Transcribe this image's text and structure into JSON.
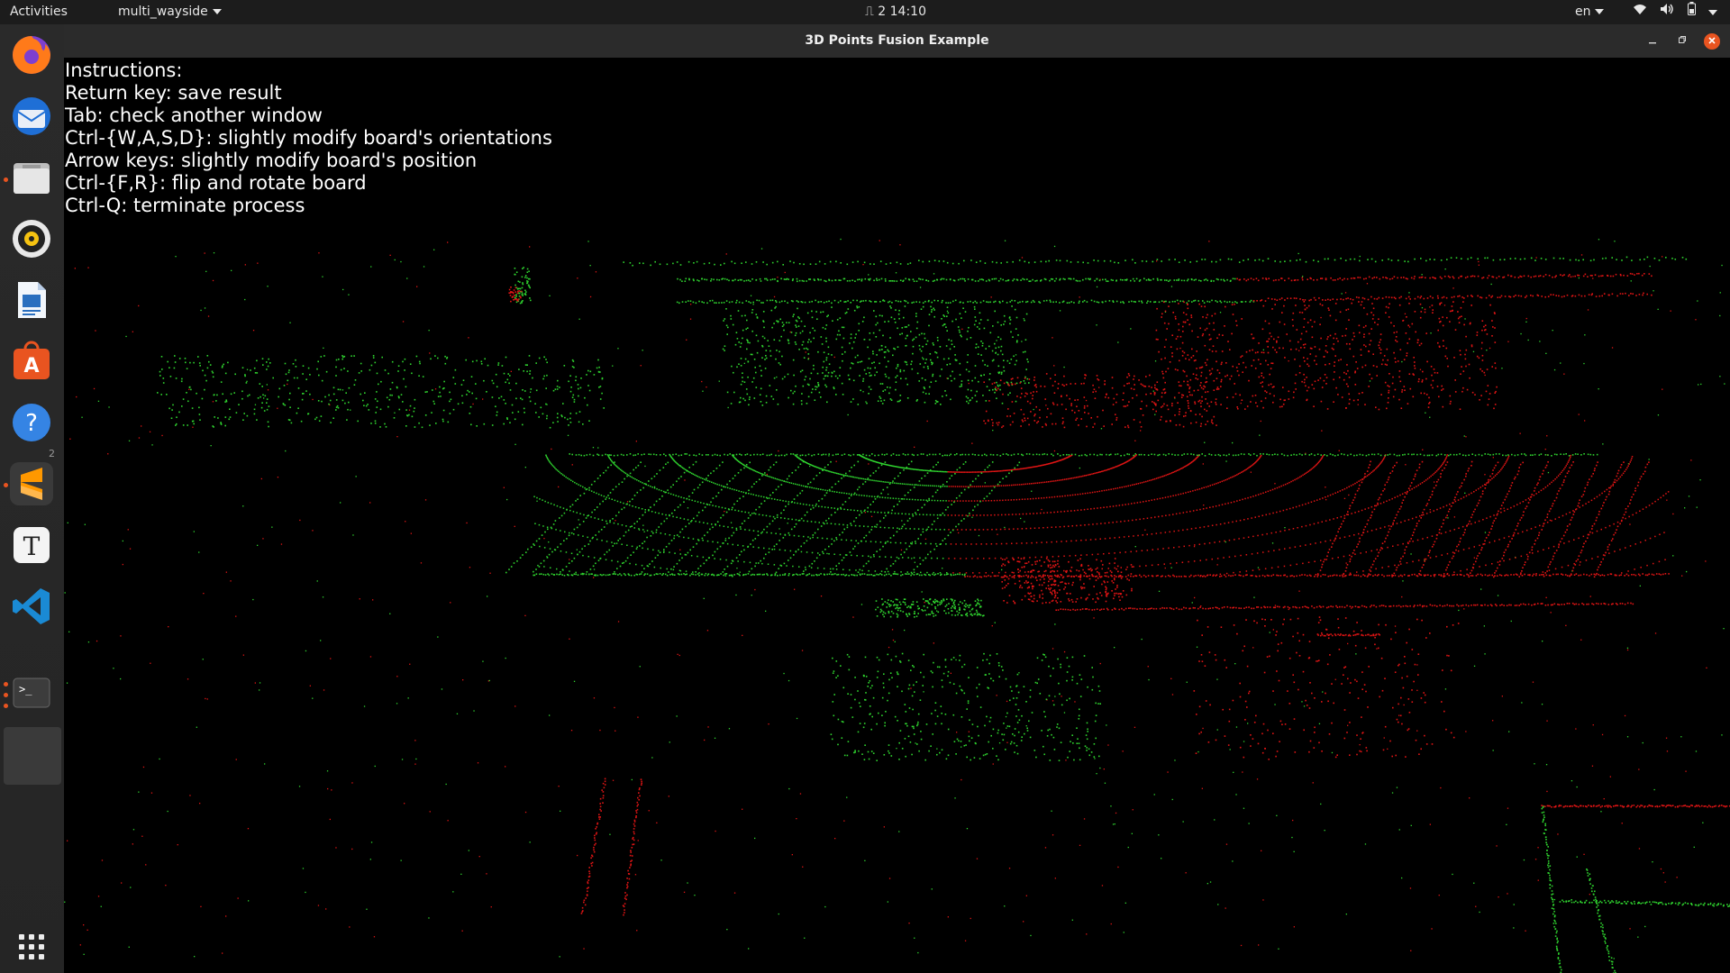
{
  "topbar": {
    "activities": "Activities",
    "app_menu": "multi_wayside",
    "workspace_indicator": "⎍ 2",
    "clock": "14:10",
    "language": "en"
  },
  "dock": {
    "items": [
      {
        "name": "firefox-icon"
      },
      {
        "name": "thunderbird-icon"
      },
      {
        "name": "files-icon"
      },
      {
        "name": "rhythmbox-icon"
      },
      {
        "name": "libreoffice-writer-icon"
      },
      {
        "name": "software-center-icon"
      },
      {
        "name": "help-icon"
      },
      {
        "name": "sublime-text-icon"
      },
      {
        "name": "text-editor-icon"
      },
      {
        "name": "vscode-icon"
      },
      {
        "name": "terminal-icon"
      },
      {
        "name": "running-app-icon"
      }
    ],
    "show_apps_icon": "grid-icon",
    "badge": "2"
  },
  "window": {
    "title": "3D Points Fusion Example"
  },
  "instructions": {
    "lines": [
      "Instructions:",
      "Return key: save result",
      "Tab: check another window",
      "Ctrl-{W,A,S,D}: slightly modify board's orientations",
      "Arrow keys: slightly modify board's position",
      "Ctrl-{F,R}: flip and rotate board",
      "Ctrl-Q: terminate process"
    ]
  },
  "colors": {
    "cloud_a": "#2fd42f",
    "cloud_b": "#e01414",
    "accent": "#e95420"
  }
}
